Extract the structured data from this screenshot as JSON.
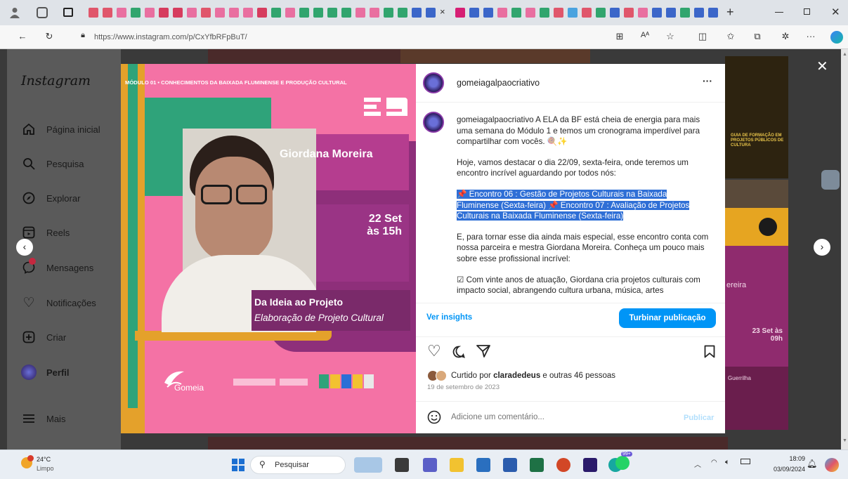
{
  "browser": {
    "url": "https://www.instagram.com/p/CxYfbRFpBuT/",
    "new_tab": "+",
    "more": "···"
  },
  "sidebar": {
    "logo": "Instagram",
    "items": [
      {
        "label": "Página inicial",
        "icon": "home-icon"
      },
      {
        "label": "Pesquisa",
        "icon": "search-icon"
      },
      {
        "label": "Explorar",
        "icon": "compass-icon"
      },
      {
        "label": "Reels",
        "icon": "reels-icon"
      },
      {
        "label": "Mensagens",
        "icon": "messenger-icon"
      },
      {
        "label": "Notificações",
        "icon": "heart-icon"
      },
      {
        "label": "Criar",
        "icon": "plus-square-icon"
      },
      {
        "label": "Perfil",
        "icon": "avatar"
      },
      {
        "label": "Mais",
        "icon": "menu-icon"
      }
    ]
  },
  "post_image": {
    "header": "MÓDULO 01 • CONHECIMENTOS DA BAIXADA FLUMINENSE E PRODUÇÃO CULTURAL",
    "name": "Giordana Moreira",
    "date_line1": "22 Set",
    "date_line2": "às 15h",
    "title": "Da Ideia ao Projeto",
    "subtitle": "Elaboração de Projeto Cultural",
    "org": "Gomeia"
  },
  "panel": {
    "username": "gomeiagalpaocriativo",
    "caption_p1": " A ELA da BF está cheia de energia para mais uma semana do Módulo 1 e temos um cronograma imperdível para compartilhar com vocês. 🍭✨",
    "caption_p2": "Hoje, vamos destacar o dia 22/09, sexta-feira, onde teremos um encontro incrível aguardando por todos nós:",
    "caption_p3": "📌 Encontro 06 : Gestão de Projetos Culturais na Baixada Fluminense (Sexta-feira) 📌 Encontro 07 : Avaliação de Projetos Culturais na Baixada Fluminense (Sexta-feira)",
    "caption_p4": "E, para tornar esse dia ainda mais especial, esse encontro conta com nossa parceira e mestra Giordana Moreira. Conheça um pouco mais sobre esse profissional incrível:",
    "caption_p5": "☑ Com vinte anos de atuação, Giordana cria projetos culturais com impacto social, abrangendo cultura urbana, música, artes",
    "insights": "Ver insights",
    "boost": "Turbinar publicação",
    "liked_by_prefix": "Curtido por ",
    "liked_by_user": "claradedeus",
    "liked_by_suffix": " e outras 46 pessoas",
    "date": "19 de setembro de 2023",
    "comment_placeholder": "Adicione um comentário...",
    "publish": "Publicar"
  },
  "background_tiles": {
    "tile_a": "GUIA DE FORMAÇÃO EM PROJETOS PÚBLICOS DE CULTURA",
    "tile_b": "23 Set às 09h",
    "tile_c": "Guerrilha",
    "tile_d": "ereira"
  },
  "taskbar": {
    "weather_temp": "24°C",
    "weather_desc": "Limpo",
    "search": "Pesquisar",
    "time": "18:09",
    "date": "03/09/2024",
    "badge": "99+"
  },
  "colors": {
    "accent": "#0095f6",
    "pink": "#f2729e",
    "purple": "#8e2f7a",
    "green": "#2fa37a",
    "highlight": "#2f6fd6"
  }
}
